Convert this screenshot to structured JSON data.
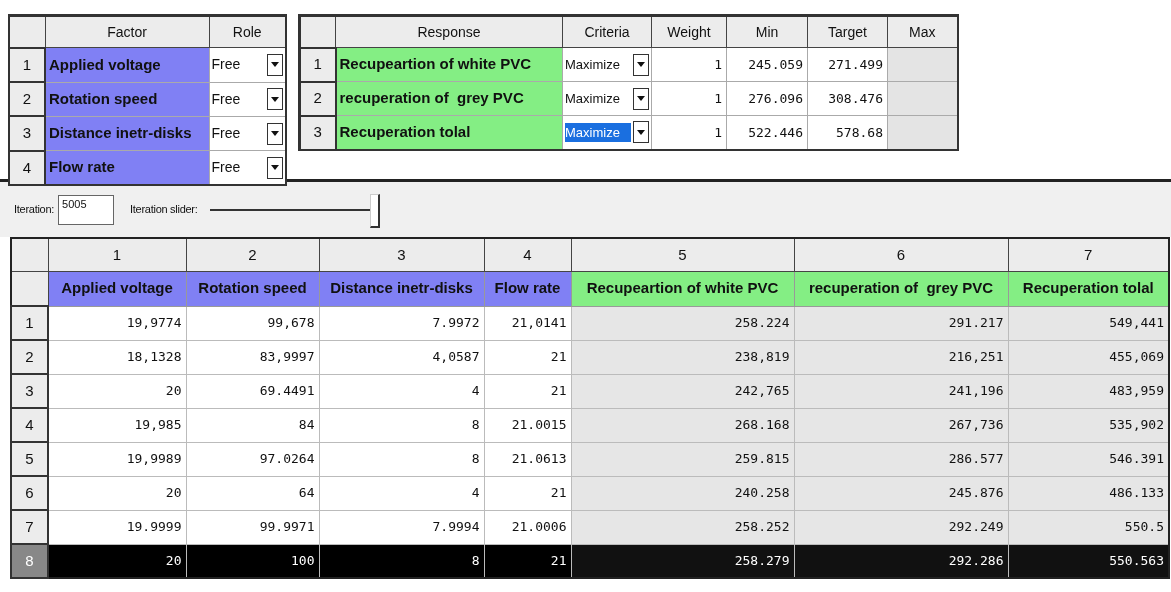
{
  "factor_table": {
    "columns": [
      "Factor",
      "Role"
    ],
    "rows": [
      {
        "index": "1",
        "name": "Applied voltage",
        "role": "Free"
      },
      {
        "index": "2",
        "name": "Rotation speed",
        "role": "Free"
      },
      {
        "index": "3",
        "name": "Distance inetr-disks",
        "role": "Free"
      },
      {
        "index": "4",
        "name": "Flow rate",
        "role": "Free"
      }
    ]
  },
  "response_table": {
    "columns": [
      "Response",
      "Criteria",
      "Weight",
      "Min",
      "Target",
      "Max"
    ],
    "rows": [
      {
        "index": "1",
        "name": "Recupeartion of white PVC",
        "criteria": "Maximize",
        "selected": false,
        "weight": "1",
        "min": "245.059",
        "target": "271.499"
      },
      {
        "index": "2",
        "name": "recuperation of  grey PVC",
        "criteria": "Maximize",
        "selected": false,
        "weight": "1",
        "min": "276.096",
        "target": "308.476"
      },
      {
        "index": "3",
        "name": "Recuperation tolal",
        "criteria": "Maximize",
        "selected": true,
        "weight": "1",
        "min": "522.446",
        "target": "578.68"
      }
    ]
  },
  "iteration": {
    "label": "Iteration:",
    "value": "5005",
    "slider_label": "Iteration slider:",
    "level": 1
  },
  "results": {
    "column_numbers": [
      "1",
      "2",
      "3",
      "4",
      "5",
      "6",
      "7"
    ],
    "columns": [
      {
        "name": "Applied voltage",
        "kind": "factor"
      },
      {
        "name": "Rotation speed",
        "kind": "factor"
      },
      {
        "name": "Distance inetr-disks",
        "kind": "factor"
      },
      {
        "name": "Flow rate",
        "kind": "factor"
      },
      {
        "name": "Recupeartion of white PVC",
        "kind": "response"
      },
      {
        "name": "recuperation of  grey PVC",
        "kind": "response"
      },
      {
        "name": "Recuperation tolal",
        "kind": "response"
      }
    ],
    "rows": [
      {
        "index": "1",
        "selected": false,
        "values": [
          "19,9774",
          "99,678",
          "7.9972",
          "21,0141",
          "258.224",
          "291.217",
          "549,441"
        ]
      },
      {
        "index": "2",
        "selected": false,
        "values": [
          "18,1328",
          "83,9997",
          "4,0587",
          "21",
          "238,819",
          "216,251",
          "455,069"
        ]
      },
      {
        "index": "3",
        "selected": false,
        "values": [
          "20",
          "69.4491",
          "4",
          "21",
          "242,765",
          "241,196",
          "483,959"
        ]
      },
      {
        "index": "4",
        "selected": false,
        "values": [
          "19,985",
          "84",
          "8",
          "21.0015",
          "268.168",
          "267,736",
          "535,902"
        ]
      },
      {
        "index": "5",
        "selected": false,
        "values": [
          "19,9989",
          "97.0264",
          "8",
          "21.0613",
          "259.815",
          "286.577",
          "546.391"
        ]
      },
      {
        "index": "6",
        "selected": false,
        "values": [
          "20",
          "64",
          "4",
          "21",
          "240.258",
          "245.876",
          "486.133"
        ]
      },
      {
        "index": "7",
        "selected": false,
        "values": [
          "19.9999",
          "99.9971",
          "7.9994",
          "21.0006",
          "258.252",
          "292.249",
          "550.5"
        ]
      },
      {
        "index": "8",
        "selected": true,
        "values": [
          "20",
          "100",
          "8",
          "21",
          "258.279",
          "292.286",
          "550.563"
        ]
      }
    ]
  }
}
